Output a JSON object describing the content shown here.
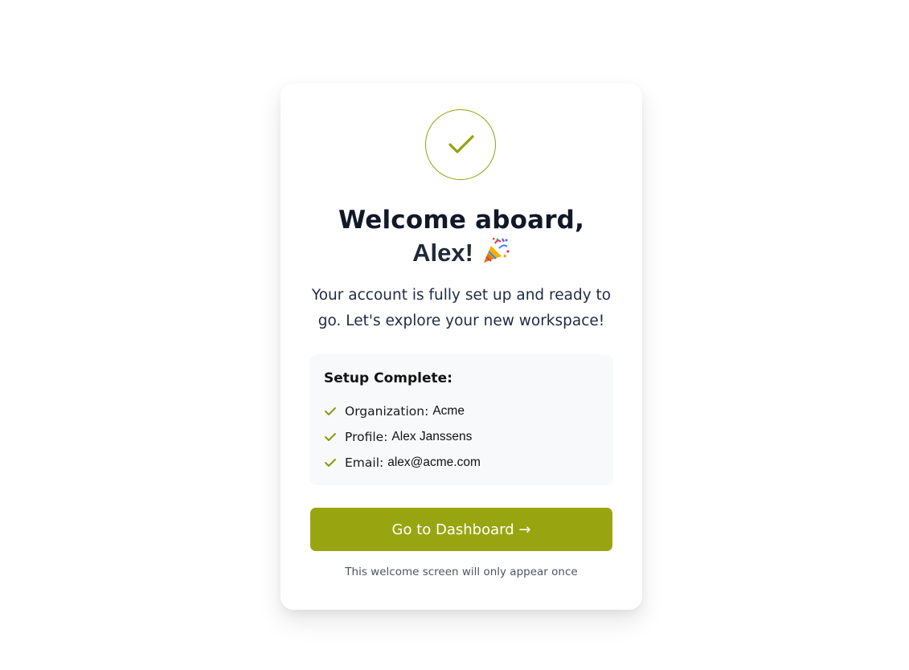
{
  "colors": {
    "accent": "#98a510",
    "heading": "#111827",
    "setup_bg": "#f8f9fa"
  },
  "icons": {
    "hero": "check-icon",
    "celebration": "party-popper-icon",
    "item_tick": "check-icon"
  },
  "welcome": {
    "title_line1": "Welcome aboard,",
    "title_line2": "Alex!",
    "subtitle": "Your account is fully set up and ready to go. Let's explore your new workspace!"
  },
  "setup": {
    "title": "Setup Complete:",
    "items": [
      {
        "label": "Organization:",
        "value": "Acme"
      },
      {
        "label": "Profile:",
        "value": "Alex Janssens"
      },
      {
        "label": "Email:",
        "value": "alex@acme.com"
      }
    ]
  },
  "actions": {
    "primary_label": "Go to Dashboard →"
  },
  "footer": {
    "note": "This welcome screen will only appear once"
  }
}
